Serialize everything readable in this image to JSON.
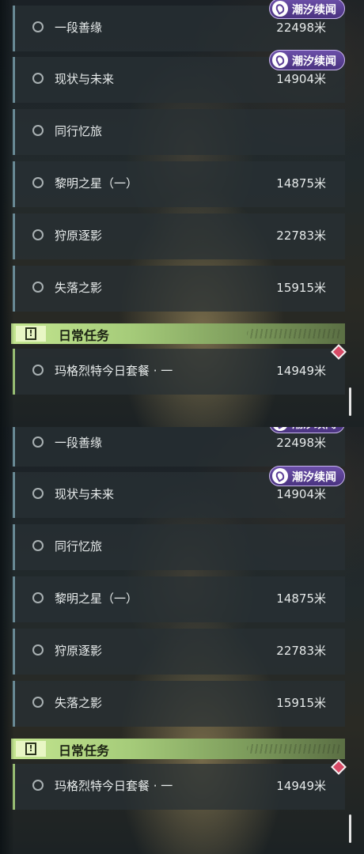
{
  "badge_label": "潮汐续闻",
  "daily_header": {
    "title": "日常任务"
  },
  "quests": [
    {
      "name": "一段善缘",
      "distance": "22498米"
    },
    {
      "name": "现状与未来",
      "distance": "14904米"
    },
    {
      "name": "同行忆旅",
      "distance": ""
    },
    {
      "name": "黎明之星（一）",
      "distance": "14875米"
    },
    {
      "name": "狩原逐影",
      "distance": "22783米"
    },
    {
      "name": "失落之影",
      "distance": "15915米"
    }
  ],
  "daily_quests": [
    {
      "name": "玛格烈特今日套餐 · 一",
      "distance": "14949米"
    }
  ],
  "colors": {
    "quest_accent": "#6c8e9a",
    "daily_accent": "#9dc476",
    "badge": "#5b3f96",
    "marker": "#d84a66"
  },
  "icons": [
    "radio-icon",
    "wave-badge-icon",
    "exclamation-icon",
    "diamond-marker-icon"
  ]
}
